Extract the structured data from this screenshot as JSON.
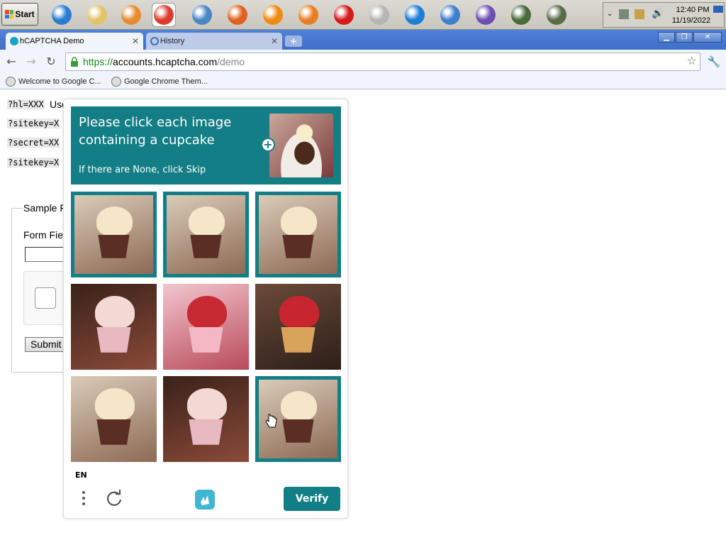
{
  "taskbar": {
    "start_label": "Start",
    "apps": [
      {
        "name": "internet-explorer-icon",
        "color": "#2b7bd3"
      },
      {
        "name": "file-manager-icon",
        "color": "#e2c36a"
      },
      {
        "name": "media-player-icon",
        "color": "#e88b2e"
      },
      {
        "name": "chrome-icon",
        "color": "#db3c2e"
      },
      {
        "name": "chromium-icon",
        "color": "#4a86c6"
      },
      {
        "name": "firefox-icon",
        "color": "#e0601f"
      },
      {
        "name": "avast-icon",
        "color": "#f08a12"
      },
      {
        "name": "ship-wheel-icon",
        "color": "#e97d22"
      },
      {
        "name": "opera-icon",
        "color": "#d51b1b"
      },
      {
        "name": "opera-gray-icon",
        "color": "#b5b5b5"
      },
      {
        "name": "maxthon-icon",
        "color": "#1c7ed8"
      },
      {
        "name": "safari-icon",
        "color": "#3e7fce"
      },
      {
        "name": "torch-icon",
        "color": "#6e4fb0"
      },
      {
        "name": "terminal-icon",
        "color": "#4b6a3a"
      },
      {
        "name": "utility-icon",
        "color": "#5a6b4a"
      }
    ],
    "clock_time": "12:40 PM",
    "clock_date": "11/19/2022"
  },
  "browser": {
    "tabs": [
      {
        "title": "hCAPTCHA Demo",
        "active": true
      },
      {
        "title": "History",
        "active": false
      }
    ],
    "new_tab_label": "+",
    "url_scheme": "https://",
    "url_host": "accounts.hcaptcha.com",
    "url_path": "/demo",
    "bookmarks": [
      "Welcome to Google C...",
      "Google Chrome Them..."
    ]
  },
  "page": {
    "params": [
      "?hl=XXX",
      "?sitekey=X",
      "?secret=XX",
      "?sitekey=X"
    ],
    "param_suffix": "Use",
    "sample_legend": "Sample F",
    "form_field_label": "Form Fie",
    "submit_label": "Submit"
  },
  "challenge": {
    "prompt": "Please click each image containing a cupcake",
    "prompt_sub": "If there are None, click Skip",
    "language": "EN",
    "verify_label": "Verify",
    "accent": "#137e85",
    "tiles": [
      {
        "subject": "cupcake",
        "selected": true
      },
      {
        "subject": "cupcake",
        "selected": true
      },
      {
        "subject": "cupcake",
        "selected": true
      },
      {
        "subject": "birthday-cake",
        "selected": false
      },
      {
        "subject": "strawberry-cake",
        "selected": false
      },
      {
        "subject": "strawberry-tart",
        "selected": false
      },
      {
        "subject": "cupcake",
        "selected": false
      },
      {
        "subject": "birthday-cake",
        "selected": false
      },
      {
        "subject": "cupcake",
        "selected": true
      }
    ]
  }
}
